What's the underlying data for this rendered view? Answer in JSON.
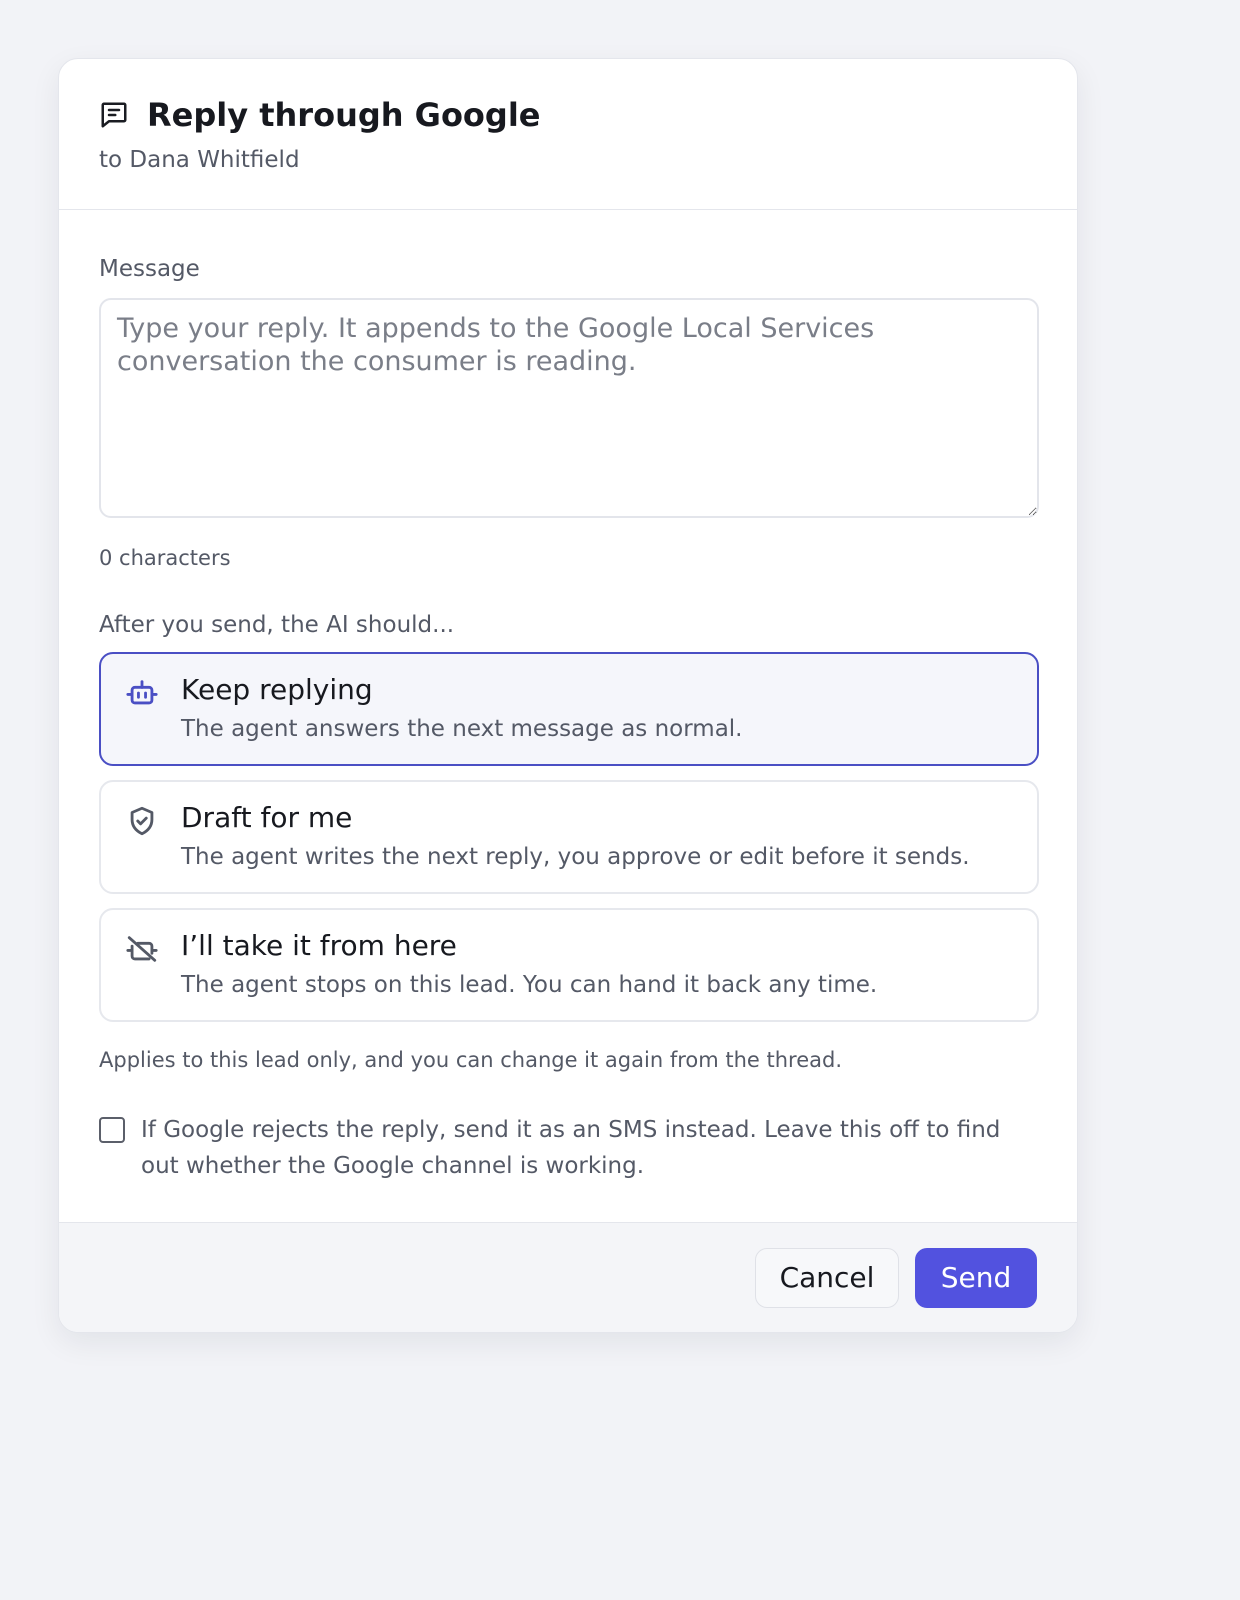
{
  "dialog": {
    "title": "Reply through Google",
    "title_icon": "message-square-icon",
    "subtitle": "to Dana Whitfield"
  },
  "message": {
    "label": "Message",
    "value": "",
    "placeholder": "Type your reply. It appends to the Google Local Services conversation the consumer is reading.",
    "char_count": "0 characters"
  },
  "ai_options": {
    "label": "After you send, the AI should...",
    "selected": "keep-replying",
    "items": [
      {
        "id": "keep-replying",
        "icon": "bot-icon",
        "title": "Keep replying",
        "description": "The agent answers the next message as normal."
      },
      {
        "id": "draft-for-me",
        "icon": "shield-check-icon",
        "title": "Draft for me",
        "description": "The agent writes the next reply, you approve or edit before it sends."
      },
      {
        "id": "take-from-here",
        "icon": "bot-off-icon",
        "title": "I’ll take it from here",
        "description": "The agent stops on this lead. You can hand it back any time."
      }
    ],
    "note": "Applies to this lead only, and you can change it again from the thread."
  },
  "sms_fallback": {
    "checked": false,
    "label": "If Google rejects the reply, send it as an SMS instead. Leave this off to find out whether the Google channel is working."
  },
  "footer": {
    "cancel_label": "Cancel",
    "send_label": "Send"
  },
  "colors": {
    "accent": "#5252df",
    "selected_border": "#4a4fc4",
    "background": "#f2f3f7"
  }
}
